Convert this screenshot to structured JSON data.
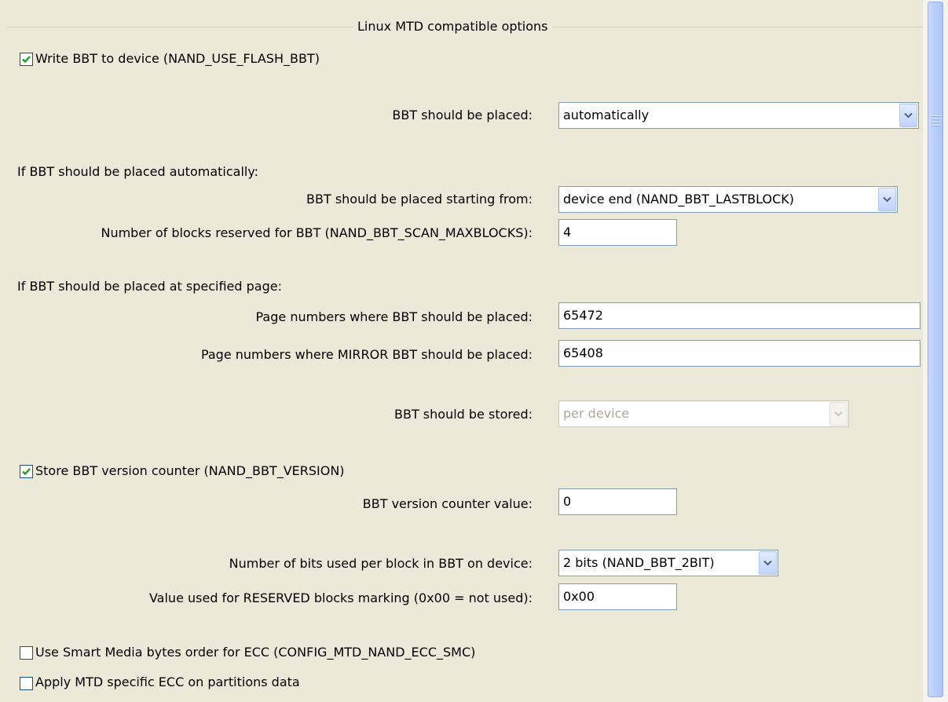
{
  "section": {
    "title": "Linux MTD compatible options"
  },
  "write_bbt": {
    "label": "Write BBT to device (NAND_USE_FLASH_BBT)",
    "checked": true
  },
  "placement": {
    "label": "BBT should be placed:",
    "value": "automatically"
  },
  "auto_heading": "If BBT should be placed automatically:",
  "start_from": {
    "label": "BBT should be placed starting from:",
    "value": "device end (NAND_BBT_LASTBLOCK)"
  },
  "reserved_blocks": {
    "label": "Number of blocks reserved for BBT (NAND_BBT_SCAN_MAXBLOCKS):",
    "value": "4"
  },
  "page_heading": "If BBT should be placed at specified page:",
  "page_numbers": {
    "label": "Page numbers where BBT should be placed:",
    "value": "65472"
  },
  "mirror_page_numbers": {
    "label": "Page numbers where MIRROR BBT should be placed:",
    "value": "65408"
  },
  "stored": {
    "label": "BBT should be stored:",
    "value": "per device",
    "disabled": true
  },
  "version_counter": {
    "label": "Store BBT version counter (NAND_BBT_VERSION)",
    "checked": true
  },
  "version_value": {
    "label": "BBT version counter value:",
    "value": "0"
  },
  "bits_per_block": {
    "label": "Number of bits used per block in BBT on device:",
    "value": "2 bits (NAND_BBT_2BIT)"
  },
  "reserved_marking": {
    "label": "Value used for RESERVED blocks marking (0x00 = not used):",
    "value": "0x00"
  },
  "smart_media": {
    "label": "Use Smart Media bytes order for ECC (CONFIG_MTD_NAND_ECC_SMC)",
    "checked": false
  },
  "mtd_ecc": {
    "label": "Apply MTD specific ECC on partitions data",
    "checked": false
  },
  "colors": {
    "background": "#ece9d8",
    "checkmark": "#21a121",
    "field_border": "#7f9db9",
    "scroll_thumb": "#b8cdfa"
  },
  "icons": [
    "checkmark-icon",
    "chevron-down-icon",
    "scroll-grip-icon"
  ]
}
